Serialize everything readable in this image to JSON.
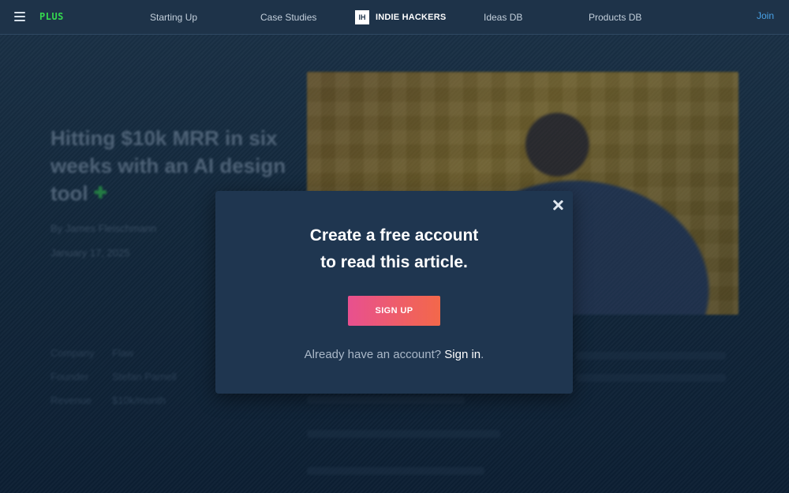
{
  "nav": {
    "plus_label": "PLUS",
    "links": [
      "Starting Up",
      "Case Studies",
      "Ideas DB",
      "Products DB"
    ],
    "brand_logo": "IH",
    "brand_name": "INDIE HACKERS",
    "join_label": "Join"
  },
  "article": {
    "title": "Hitting $10k MRR in six weeks with an AI design tool",
    "plus_symbol": "✚",
    "byline": "By James Fleischmann",
    "date": "January 17, 2025",
    "meta": [
      {
        "key": "Company",
        "value": "Flaw"
      },
      {
        "key": "Founder",
        "value": "Stefan Parnell"
      },
      {
        "key": "Revenue",
        "value": "$10k/month"
      }
    ]
  },
  "modal": {
    "heading_line1": "Create a free account",
    "heading_line2": "to read this article.",
    "signup_label": "SIGN UP",
    "already_text": "Already have an account? ",
    "signin_label": "Sign in",
    "period": "."
  },
  "colors": {
    "plus": "#35d84f",
    "join": "#4aa3e8",
    "signup_gradient_start": "#e8508f",
    "signup_gradient_end": "#f3684a",
    "modal_bg": "#1f3650"
  },
  "icons": [
    "menu-icon",
    "close-icon"
  ]
}
